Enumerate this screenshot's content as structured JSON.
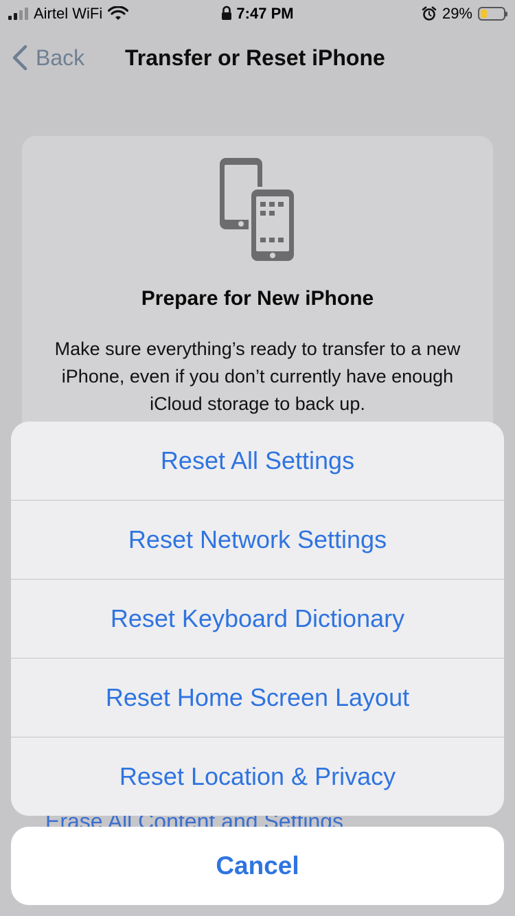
{
  "status_bar": {
    "carrier": "Airtel WiFi",
    "time": "7:47 PM",
    "battery_percent": "29%",
    "battery_level": 0.29,
    "icons": [
      "signal-icon",
      "wifi-icon",
      "lock-icon",
      "alarm-icon",
      "battery-icon"
    ]
  },
  "nav": {
    "back_label": "Back",
    "title": "Transfer or Reset iPhone"
  },
  "card": {
    "icon": "transfer-phones-icon",
    "title": "Prepare for New iPhone",
    "description": "Make sure everything’s ready to transfer to a new iPhone, even if you don’t currently have enough iCloud storage to back up."
  },
  "erase_label": "Erase All Content and Settings",
  "action_sheet": {
    "items": [
      {
        "label": "Reset All Settings"
      },
      {
        "label": "Reset Network Settings"
      },
      {
        "label": "Reset Keyboard Dictionary"
      },
      {
        "label": "Reset Home Screen Layout"
      },
      {
        "label": "Reset Location & Privacy"
      }
    ],
    "cancel_label": "Cancel"
  },
  "colors": {
    "accent": "#2f74e0",
    "dimmed_background": "#c6c6c9",
    "sheet_background": "#eeeef0",
    "battery_fill": "#f4c430"
  }
}
